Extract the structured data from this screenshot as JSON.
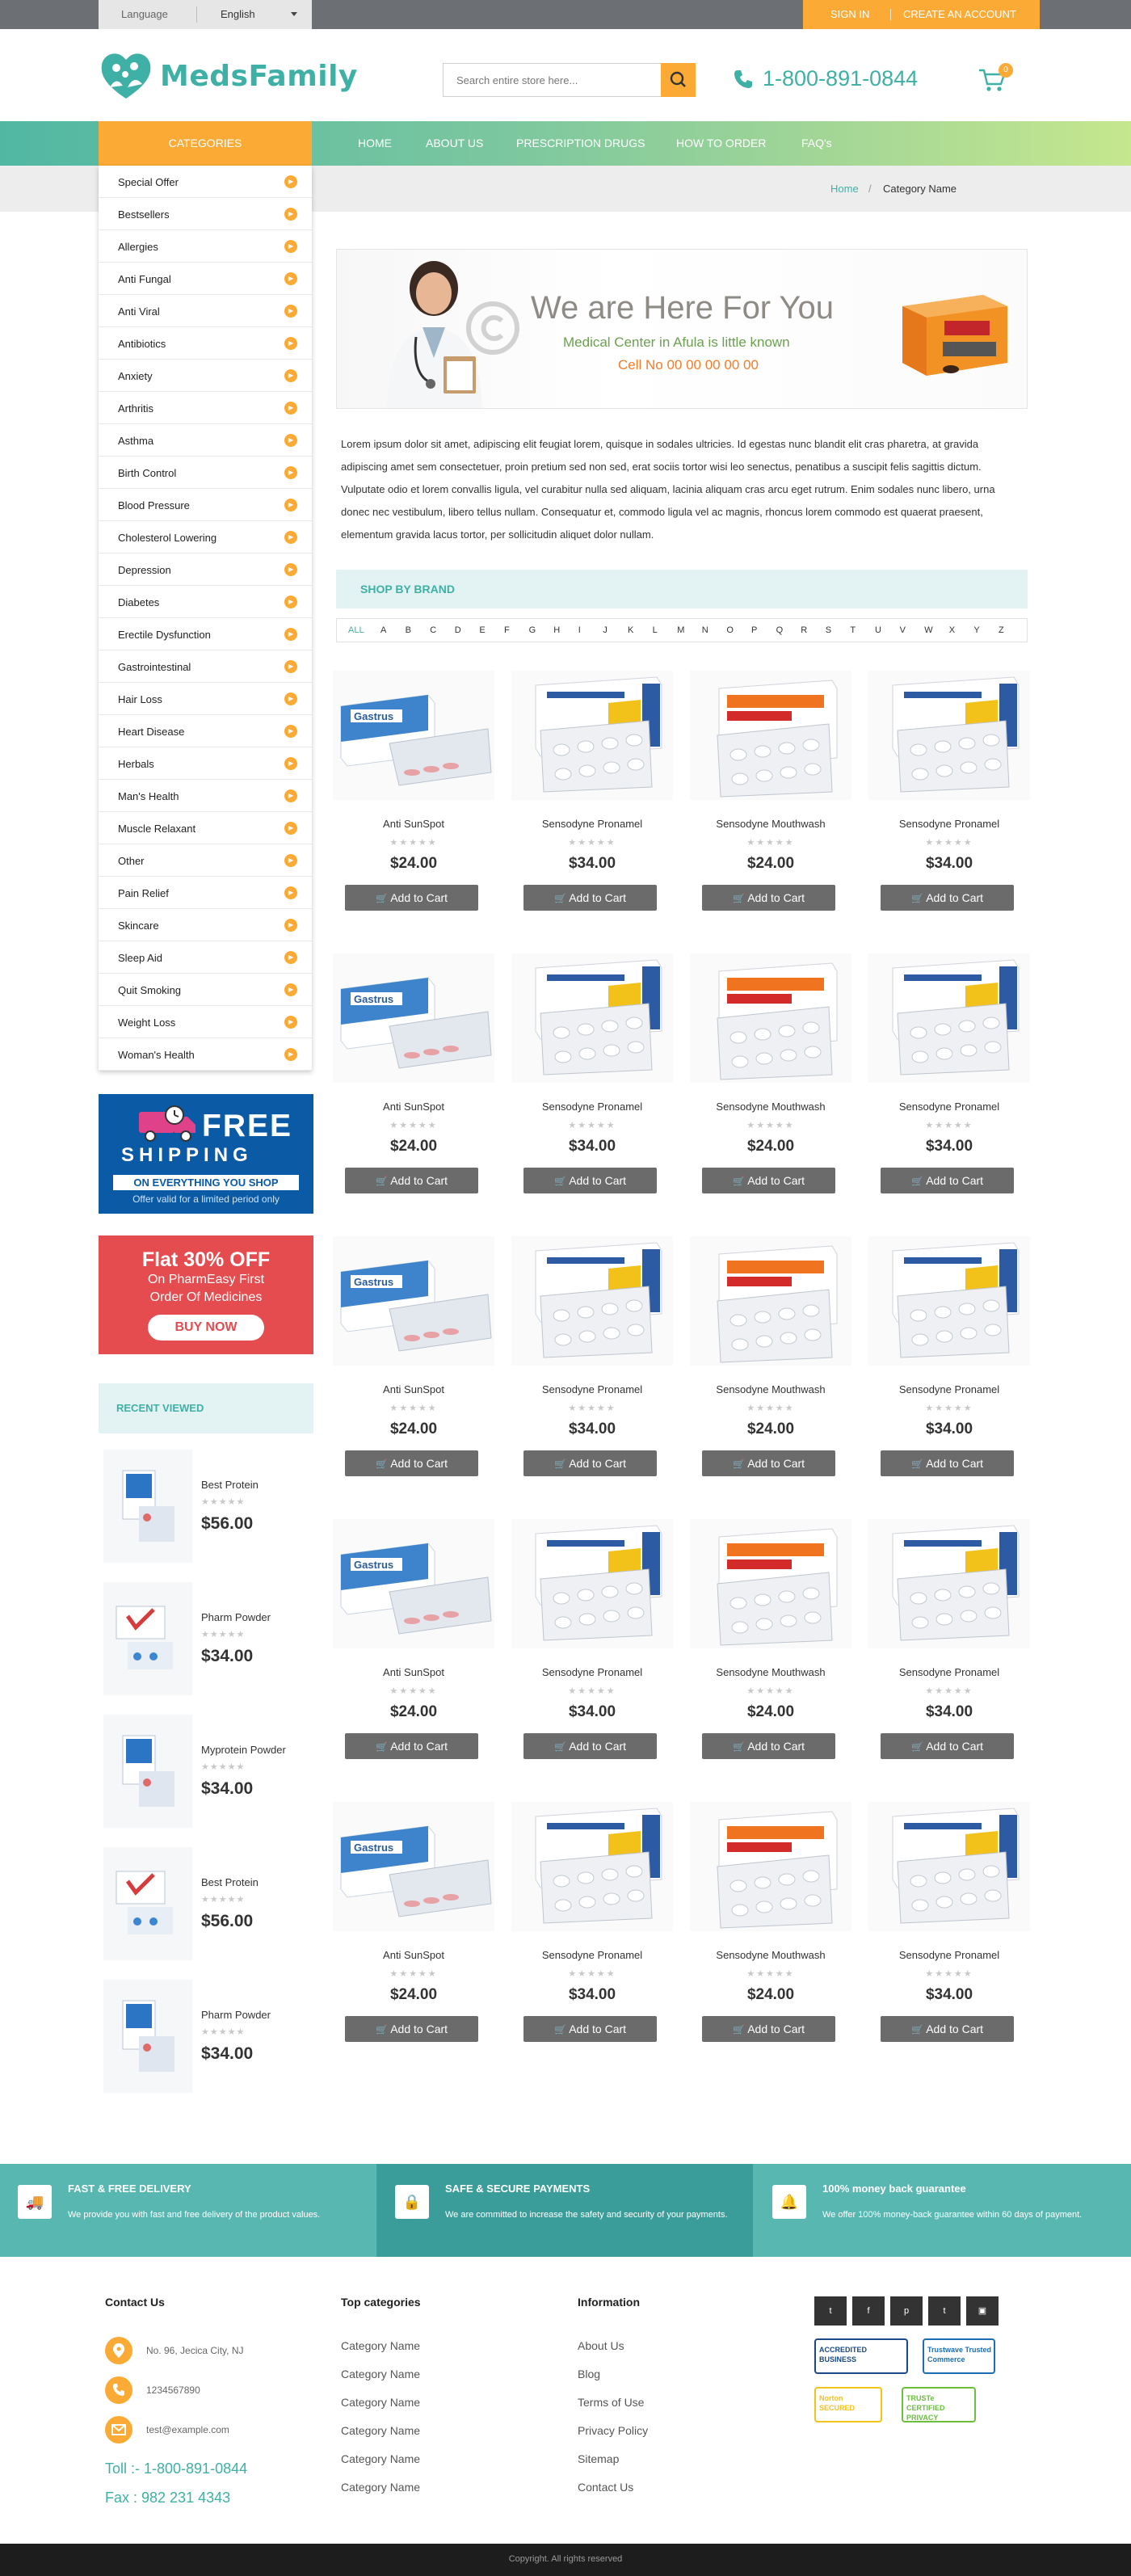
{
  "topbar": {
    "language_label": "Language",
    "language_value": "English",
    "sign_in": "SIGN IN",
    "create_account": "CREATE AN ACCOUNT"
  },
  "header": {
    "brand": "MedsFamily",
    "search_placeholder": "Search entire store here...",
    "phone": "1-800-891-0844",
    "cart_count": "0"
  },
  "colors": {
    "primary_teal": "#3fb0a5",
    "accent_orange": "#fbab35",
    "button_gray": "#6b6b6b"
  },
  "nav": {
    "categories_label": "CATEGORIES",
    "links": [
      "HOME",
      "ABOUT US",
      "PRESCRIPTION DRUGS",
      "HOW TO ORDER",
      "FAQ's"
    ]
  },
  "breadcrumb": {
    "home": "Home",
    "separator": "/",
    "current": "Category Name"
  },
  "categories": [
    "Special Offer",
    "Bestsellers",
    "Allergies",
    "Anti Fungal",
    "Anti Viral",
    "Antibiotics",
    "Anxiety",
    "Arthritis",
    "Asthma",
    "Birth Control",
    "Blood Pressure",
    "Cholesterol Lowering",
    "Depression",
    "Diabetes",
    "Erectile Dysfunction",
    "Gastrointestinal",
    "Hair Loss",
    "Heart Disease",
    "Herbals",
    "Man's Health",
    "Muscle Relaxant",
    "Other",
    "Pain Relief",
    "Skincare",
    "Sleep Aid",
    "Quit Smoking",
    "Weight Loss",
    "Woman's Health"
  ],
  "shipping_banner": {
    "free": "FREE",
    "shipping": "SHIPPING",
    "strip": "ON EVERYTHING YOU SHOP",
    "note": "Offer valid for a limited period only"
  },
  "offer_banner": {
    "title": "Flat 30% OFF",
    "line1": "On PharmEasy First",
    "line2": "Order Of Medicines",
    "button": "BUY NOW"
  },
  "recent": {
    "title": "RECENT VIEWED",
    "items": [
      {
        "name": "Best Protein",
        "price": "$56.00"
      },
      {
        "name": "Pharm Powder",
        "price": "$34.00"
      },
      {
        "name": "Myprotein Powder",
        "price": "$34.00"
      },
      {
        "name": "Best Protein",
        "price": "$56.00"
      },
      {
        "name": "Pharm Powder",
        "price": "$34.00"
      }
    ]
  },
  "hero": {
    "title": "We are Here For You",
    "subtitle": "Medical Center in Afula is little known",
    "cell": "Cell No 00 00 00 00 00"
  },
  "intro": "Lorem ipsum dolor sit amet, adipiscing elit feugiat lorem, quisque in sodales ultricies. Id egestas nunc blandit elit cras pharetra, at gravida adipiscing amet sem consectetuer, proin pretium sed non sed, erat sociis tortor wisi leo senectus, penatibus a suscipit felis sagittis dictum. Vulputate odio et lorem convallis ligula, vel curabitur nulla sed aliquam, lacinia aliquam cras arcu eget rutrum. Enim sodales nunc libero, urna donec nec vestibulum, libero tellus nullam. Consequatur et, commodo ligula vel ac magnis, rhoncus lorem commodo est quaerat praesent, elementum gravida lacus tortor, per sollicitudin aliquet dolor nullam.",
  "brand_section": {
    "title": "SHOP BY BRAND",
    "letters": [
      "ALL",
      "A",
      "B",
      "C",
      "D",
      "E",
      "F",
      "G",
      "H",
      "I",
      "J",
      "K",
      "L",
      "M",
      "N",
      "O",
      "P",
      "Q",
      "R",
      "S",
      "T",
      "U",
      "V",
      "W",
      "X",
      "Y",
      "Z"
    ]
  },
  "product_row": [
    {
      "name": "Anti SunSpot",
      "price": "$24.00",
      "image": "gastrus-box"
    },
    {
      "name": "Sensodyne Pronamel",
      "price": "$34.00",
      "image": "yellow-blister-box"
    },
    {
      "name": "Sensodyne Mouthwash",
      "price": "$24.00",
      "image": "orange-blister-box"
    },
    {
      "name": "Sensodyne Pronamel",
      "price": "$34.00",
      "image": "yellow-blister-box"
    }
  ],
  "product_row_count": 5,
  "add_to_cart": "Add to Cart",
  "features": [
    {
      "title": "FAST & FREE DELIVERY",
      "text": "We provide you with fast and free delivery of the product values.",
      "icon": "truck-icon"
    },
    {
      "title": "SAFE & SECURE PAYMENTS",
      "text": "We are committed to increase the safety and security of your payments.",
      "icon": "lock-icon"
    },
    {
      "title": "100% money back guarantee",
      "text": "We offer 100% money-back guarantee within 60 days of payment.",
      "icon": "bell-icon"
    }
  ],
  "footer": {
    "contact_title": "Contact Us",
    "address": "No. 96, Jecica City, NJ",
    "phone": "1234567890",
    "email": "test@example.com",
    "toll": "Toll :- 1-800-891-0844",
    "fax": "Fax : 982 231 4343",
    "top_categories_title": "Top categories",
    "top_categories": [
      "Category Name",
      "Category Name",
      "Category Name",
      "Category Name",
      "Category Name",
      "Category Name"
    ],
    "information_title": "Information",
    "information": [
      "About Us",
      "Blog",
      "Terms of Use",
      "Privacy Policy",
      "Sitemap",
      "Contact Us"
    ],
    "social": [
      "twitter-icon",
      "facebook-icon",
      "pinterest-icon",
      "tumblr-icon",
      "instagram-icon"
    ],
    "seals": [
      {
        "icon": "bbb-seal",
        "text": "ACCREDITED BUSINESS"
      },
      {
        "icon": "trustwave-seal",
        "text": "Trustwave Trusted Commerce"
      },
      {
        "icon": "norton-seal",
        "text": "Norton SECURED"
      },
      {
        "icon": "truste-seal",
        "text": "TRUSTe CERTIFIED PRIVACY"
      }
    ],
    "copyright": "Copyright. All rights reserved"
  }
}
